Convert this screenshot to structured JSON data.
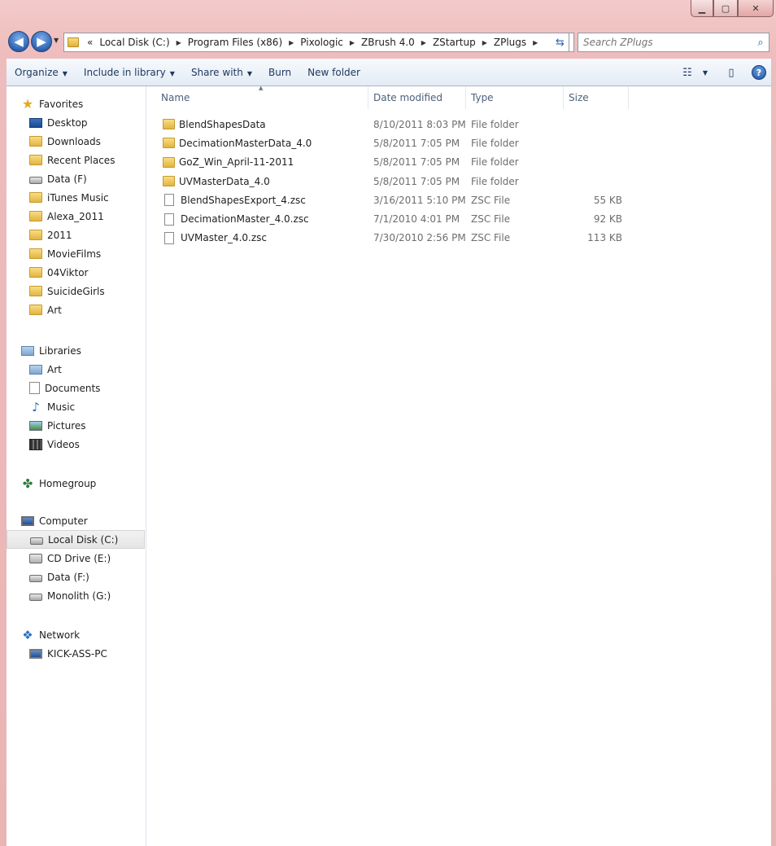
{
  "window": {
    "controls": {
      "minimize": "▁",
      "maximize": "▢",
      "close": "✕"
    }
  },
  "address": {
    "overflow": "«",
    "crumbs": [
      "Local Disk (C:)",
      "Program Files (x86)",
      "Pixologic",
      "ZBrush 4.0",
      "ZStartup",
      "ZPlugs"
    ]
  },
  "search": {
    "placeholder": "Search ZPlugs"
  },
  "toolbar": {
    "organize": "Organize",
    "include_in_library": "Include in library",
    "share_with": "Share with",
    "burn": "Burn",
    "new_folder": "New folder",
    "help": "?"
  },
  "nav": {
    "favorites": {
      "label": "Favorites",
      "items": [
        "Desktop",
        "Downloads",
        "Recent Places",
        "Data (F)",
        "iTunes Music",
        "Alexa_2011",
        "2011",
        "MovieFilms",
        "04Viktor",
        "SuicideGirls",
        "Art"
      ]
    },
    "libraries": {
      "label": "Libraries",
      "items": [
        "Art",
        "Documents",
        "Music",
        "Pictures",
        "Videos"
      ]
    },
    "homegroup": {
      "label": "Homegroup"
    },
    "computer": {
      "label": "Computer",
      "items": [
        "Local Disk (C:)",
        "CD Drive (E:)",
        "Data (F:)",
        "Monolith (G:)"
      ]
    },
    "network": {
      "label": "Network",
      "items": [
        "KICK-ASS-PC"
      ]
    }
  },
  "columns": {
    "name": "Name",
    "date": "Date modified",
    "type": "Type",
    "size": "Size"
  },
  "files": [
    {
      "name": "BlendShapesData",
      "date": "8/10/2011 8:03 PM",
      "type": "File folder",
      "size": "",
      "kind": "folder"
    },
    {
      "name": "DecimationMasterData_4.0",
      "date": "5/8/2011 7:05 PM",
      "type": "File folder",
      "size": "",
      "kind": "folder"
    },
    {
      "name": "GoZ_Win_April-11-2011",
      "date": "5/8/2011 7:05 PM",
      "type": "File folder",
      "size": "",
      "kind": "folder"
    },
    {
      "name": "UVMasterData_4.0",
      "date": "5/8/2011 7:05 PM",
      "type": "File folder",
      "size": "",
      "kind": "folder"
    },
    {
      "name": "BlendShapesExport_4.zsc",
      "date": "3/16/2011 5:10 PM",
      "type": "ZSC File",
      "size": "55 KB",
      "kind": "file"
    },
    {
      "name": "DecimationMaster_4.0.zsc",
      "date": "7/1/2010 4:01 PM",
      "type": "ZSC File",
      "size": "92 KB",
      "kind": "file"
    },
    {
      "name": "UVMaster_4.0.zsc",
      "date": "7/30/2010 2:56 PM",
      "type": "ZSC File",
      "size": "113 KB",
      "kind": "file"
    }
  ]
}
